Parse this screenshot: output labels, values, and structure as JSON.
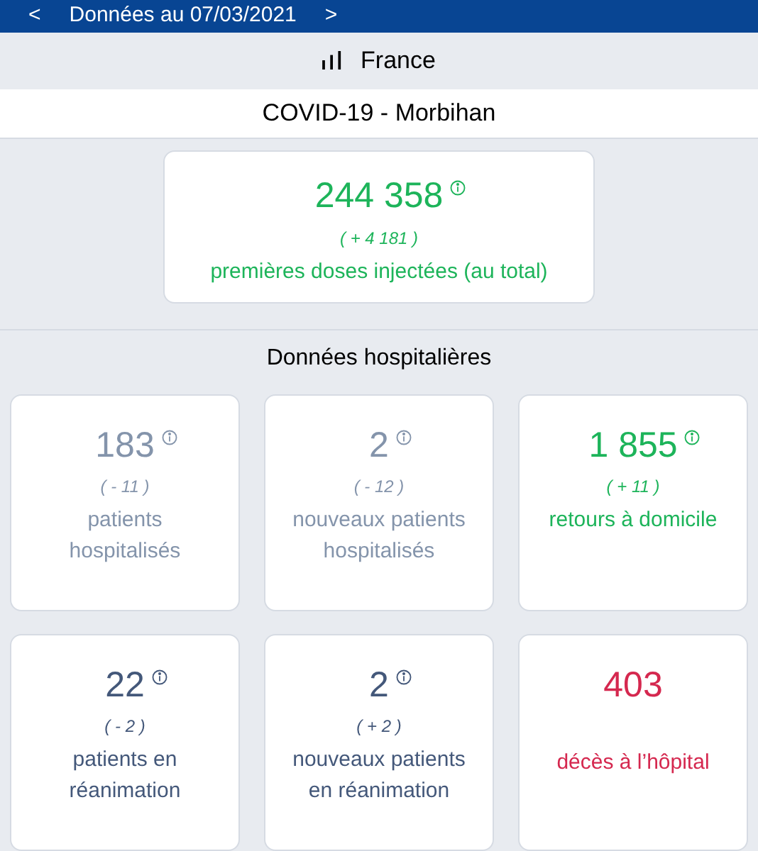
{
  "header": {
    "prev": "<",
    "title": "Données au 07/03/2021",
    "next": ">"
  },
  "scope": {
    "label": "France"
  },
  "title": "COVID-19 - Morbihan",
  "vaccine": {
    "value": "244 358",
    "delta": "( + 4 181 )",
    "label": "premières doses injectées (au total)",
    "color": "#1db45a",
    "info": true
  },
  "section_title": "Données hospitalières",
  "cards": [
    {
      "value": "183",
      "delta": "( - 11 )",
      "label": "patients hospitalisés",
      "color": "#8494ab",
      "info": true
    },
    {
      "value": "2",
      "delta": "( - 12 )",
      "label": "nouveaux patients hospitalisés",
      "color": "#8494ab",
      "info": true
    },
    {
      "value": "1 855",
      "delta": "( + 11 )",
      "label": "retours à domicile",
      "color": "#1db45a",
      "info": true
    },
    {
      "value": "22",
      "delta": "( - 2 )",
      "label": "patients en réanimation",
      "color": "#44587a",
      "info": true
    },
    {
      "value": "2",
      "delta": "( + 2 )",
      "label": "nouveaux patients en réanimation",
      "color": "#44587a",
      "info": true
    },
    {
      "value": "403",
      "label": "décès à l’hôpital",
      "color": "#d5284f",
      "info": false
    }
  ]
}
